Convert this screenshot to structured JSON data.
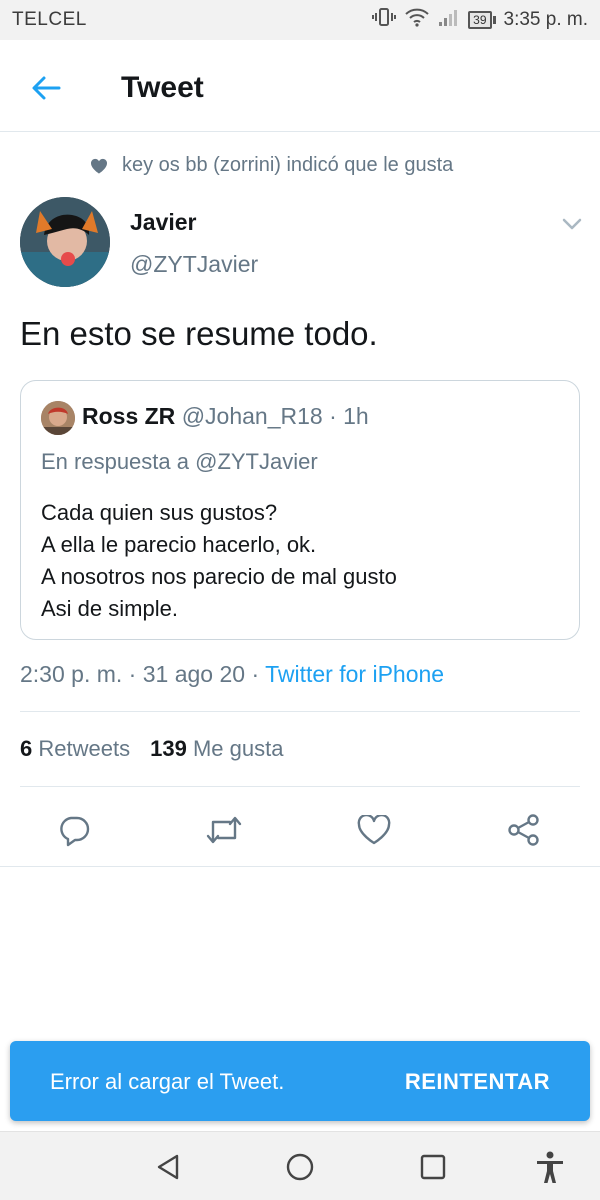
{
  "status_bar": {
    "carrier": "TELCEL",
    "battery": "39",
    "time": "3:35 p. m."
  },
  "header": {
    "title": "Tweet"
  },
  "social_context": {
    "text": "key os bb (zorrini) indicó que le gusta"
  },
  "author": {
    "name": "Javier",
    "handle": "@ZYTJavier"
  },
  "tweet": {
    "text": "En esto se resume todo."
  },
  "quoted": {
    "name": "Ross ZR",
    "handle": "@Johan_R18",
    "time": "· 1h",
    "reply_prefix": "En respuesta a",
    "reply_mention": "@ZYTJavier",
    "lines": [
      "Cada quien sus gustos?",
      "A ella le parecio hacerlo, ok.",
      "A nosotros nos parecio de mal gusto",
      "Asi de simple."
    ]
  },
  "meta": {
    "time": "2:30 p. m.",
    "date": "31 ago 20",
    "separator": "·",
    "source": "Twitter for iPhone"
  },
  "stats": {
    "retweets_count": "6",
    "retweets_label": "Retweets",
    "likes_count": "139",
    "likes_label": "Me gusta"
  },
  "toast": {
    "message": "Error al cargar el Tweet.",
    "action": "REINTENTAR"
  },
  "colors": {
    "accent": "#1da1f2",
    "secondary_text": "#657786",
    "toast_bg": "#2b9ef0"
  },
  "icons": {
    "back": "arrow-left-icon",
    "heart": "heart-icon",
    "caret": "chevron-down-icon",
    "reply": "reply-icon",
    "retweet": "retweet-icon",
    "like": "like-icon",
    "share": "share-icon"
  }
}
